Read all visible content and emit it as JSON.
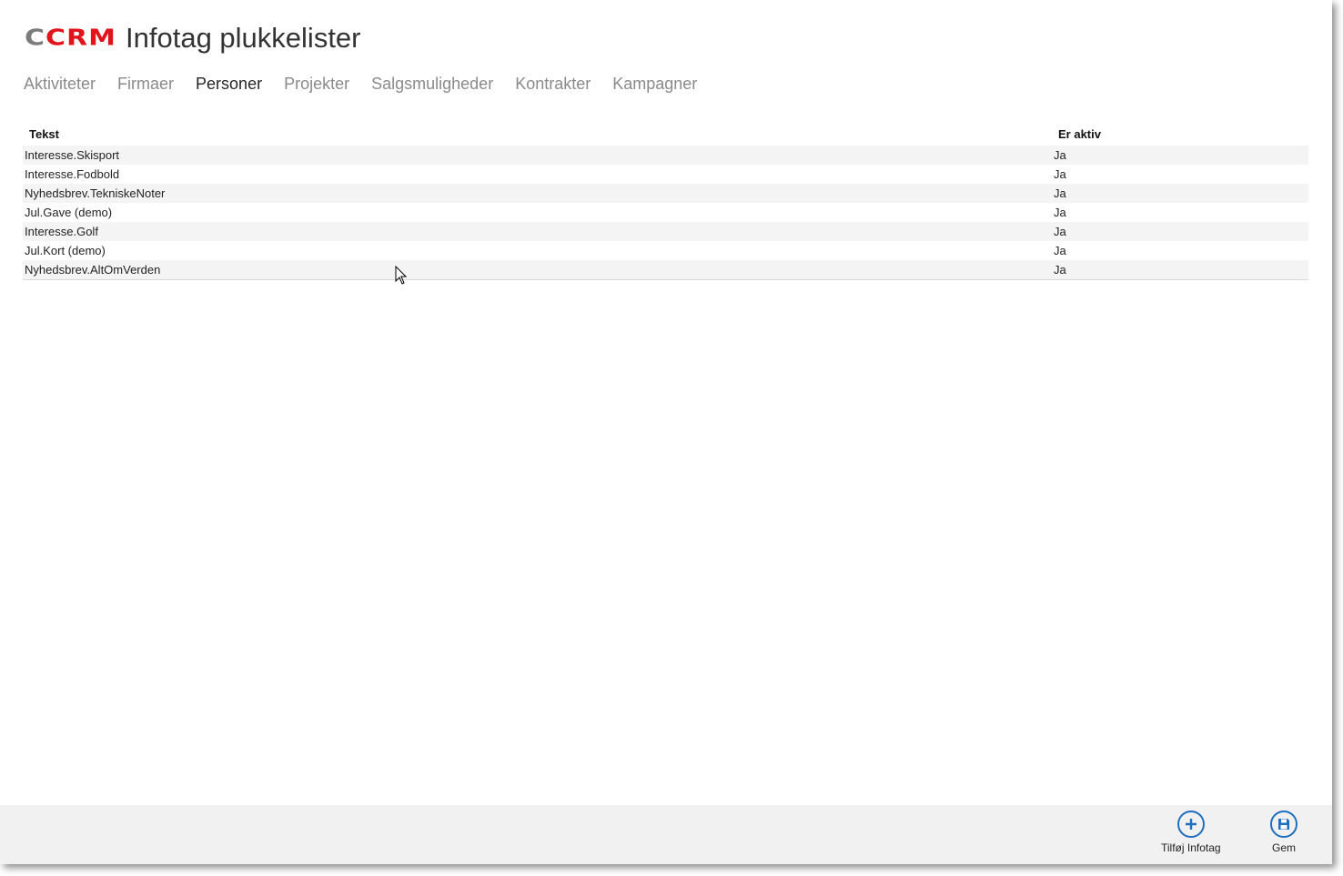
{
  "header": {
    "logo": {
      "c": "C",
      "rest": "CRM"
    },
    "title": "Infotag plukkelister"
  },
  "nav": {
    "items": [
      {
        "label": "Aktiviteter"
      },
      {
        "label": "Firmaer"
      },
      {
        "label": "Personer"
      },
      {
        "label": "Projekter"
      },
      {
        "label": "Salgsmuligheder"
      },
      {
        "label": "Kontrakter"
      },
      {
        "label": "Kampagner"
      }
    ],
    "active": "Personer"
  },
  "grid": {
    "columns": {
      "text": "Tekst",
      "active": "Er aktiv"
    },
    "rows": [
      {
        "text": "Interesse.Skisport",
        "active": "Ja"
      },
      {
        "text": "Interesse.Fodbold",
        "active": "Ja"
      },
      {
        "text": "Nyhedsbrev.TekniskeNoter",
        "active": "Ja"
      },
      {
        "text": "Jul.Gave (demo)",
        "active": "Ja"
      },
      {
        "text": "Interesse.Golf",
        "active": "Ja"
      },
      {
        "text": "Jul.Kort (demo)",
        "active": "Ja"
      },
      {
        "text": "Nyhedsbrev.AltOmVerden",
        "active": "Ja"
      }
    ]
  },
  "footer": {
    "add_label": "Tilføj Infotag",
    "save_label": "Gem"
  },
  "colors": {
    "accent": "#1f6fc0",
    "logo_red": "#e1131b",
    "logo_gray": "#7b7b7b"
  }
}
